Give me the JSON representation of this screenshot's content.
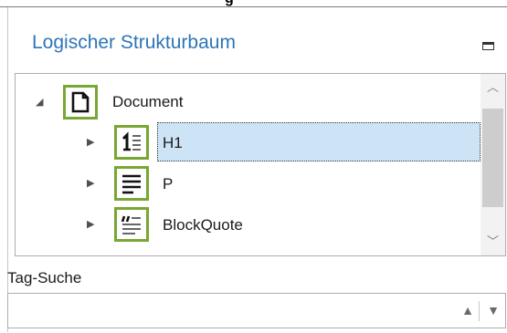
{
  "panel": {
    "title": "Logischer Strukturbaum",
    "top_fragment": "g"
  },
  "tree": {
    "items": [
      {
        "label": "Document",
        "icon": "document-icon",
        "arrow": "expanded"
      },
      {
        "label": "H1",
        "icon": "heading1-icon",
        "arrow": "collapsed",
        "selected": true
      },
      {
        "label": "P",
        "icon": "paragraph-icon",
        "arrow": "collapsed"
      },
      {
        "label": "BlockQuote",
        "icon": "blockquote-icon",
        "arrow": "collapsed"
      }
    ]
  },
  "search": {
    "label": "Tag-Suche",
    "value": "",
    "placeholder": ""
  },
  "colors": {
    "title": "#2e75b6",
    "icon_highlight": "#78a733",
    "selection": "#cde4f7"
  }
}
